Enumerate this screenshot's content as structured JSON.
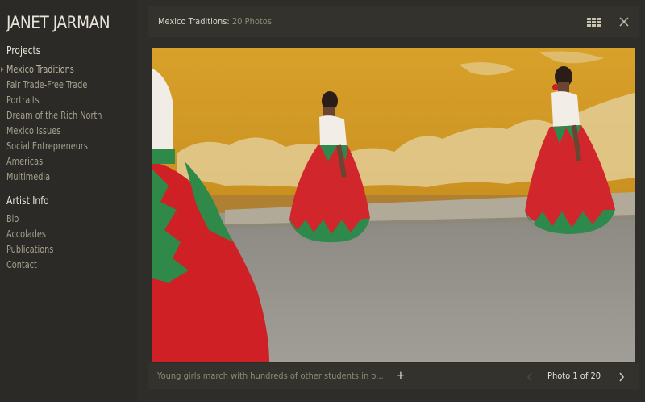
{
  "site": {
    "title": "JANET JARMAN"
  },
  "nav": {
    "projects_heading": "Projects",
    "projects": [
      {
        "label": "Mexico Traditions",
        "active": true
      },
      {
        "label": "Fair Trade-Free Trade"
      },
      {
        "label": "Portraits"
      },
      {
        "label": "Dream of the Rich North"
      },
      {
        "label": "Mexico Issues"
      },
      {
        "label": "Social Entrepreneurs"
      },
      {
        "label": "Americas"
      },
      {
        "label": "Multimedia"
      }
    ],
    "artist_heading": "Artist Info",
    "artist": [
      {
        "label": "Bio"
      },
      {
        "label": "Accolades"
      },
      {
        "label": "Publications"
      },
      {
        "label": "Contact"
      }
    ]
  },
  "gallery": {
    "title": "Mexico Traditions:",
    "count": "20 Photos",
    "caption": "Young girls march with hundreds of other students in o...",
    "more_label": "+",
    "counter": "Photo 1 of 20",
    "icons": {
      "grid": "grid-view-icon",
      "close": "close-icon",
      "prev": "chevron-left-icon",
      "next": "chevron-right-icon"
    }
  },
  "colors": {
    "background": "#2e2d29",
    "bar": "#33322d",
    "nav_text": "#a6a08c",
    "wall": "#d5a12c",
    "dress_red": "#d1262b",
    "dress_green": "#2e8a4c"
  }
}
